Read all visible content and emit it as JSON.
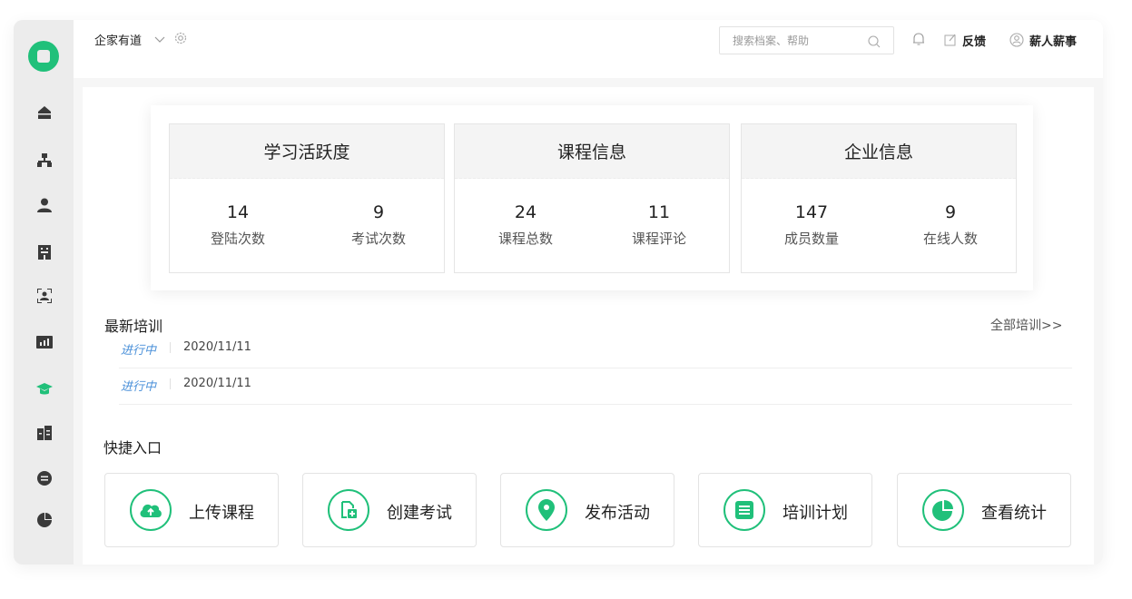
{
  "colors": {
    "accent": "#20c07a",
    "link": "#4a90d9",
    "sidebar_bg": "#ececec"
  },
  "sidebar": {
    "items": [
      {
        "icon": "home-icon"
      },
      {
        "icon": "org-chart-icon"
      },
      {
        "icon": "user-icon"
      },
      {
        "icon": "building-icon"
      },
      {
        "icon": "face-scan-icon"
      },
      {
        "icon": "bar-chart-icon"
      },
      {
        "icon": "graduation-cap-icon",
        "active": true
      },
      {
        "icon": "document-icon"
      },
      {
        "icon": "exchange-icon"
      },
      {
        "icon": "pie-chart-icon"
      }
    ]
  },
  "header": {
    "brand": "企家有道",
    "search_placeholder": "搜索档案、帮助",
    "feedback": "反馈",
    "user": "薪人薪事"
  },
  "stats": [
    {
      "title": "学习活跃度",
      "metrics": [
        {
          "value": "14",
          "label": "登陆次数"
        },
        {
          "value": "9",
          "label": "考试次数"
        }
      ]
    },
    {
      "title": "课程信息",
      "metrics": [
        {
          "value": "24",
          "label": "课程总数"
        },
        {
          "value": "11",
          "label": "课程评论"
        }
      ]
    },
    {
      "title": "企业信息",
      "metrics": [
        {
          "value": "147",
          "label": "成员数量"
        },
        {
          "value": "9",
          "label": "在线人数"
        }
      ]
    }
  ],
  "training": {
    "title": "最新培训",
    "all_link": "全部培训>>",
    "items": [
      {
        "status": "进行中",
        "date": "2020/11/11"
      },
      {
        "status": "进行中",
        "date": "2020/11/11"
      }
    ]
  },
  "quick": {
    "title": "快捷入口",
    "items": [
      {
        "label": "上传课程",
        "icon": "cloud-upload-icon"
      },
      {
        "label": "创建考试",
        "icon": "new-file-icon"
      },
      {
        "label": "发布活动",
        "icon": "map-pin-icon"
      },
      {
        "label": "培训计划",
        "icon": "list-icon"
      },
      {
        "label": "查看统计",
        "icon": "pie-chart-icon"
      }
    ]
  }
}
